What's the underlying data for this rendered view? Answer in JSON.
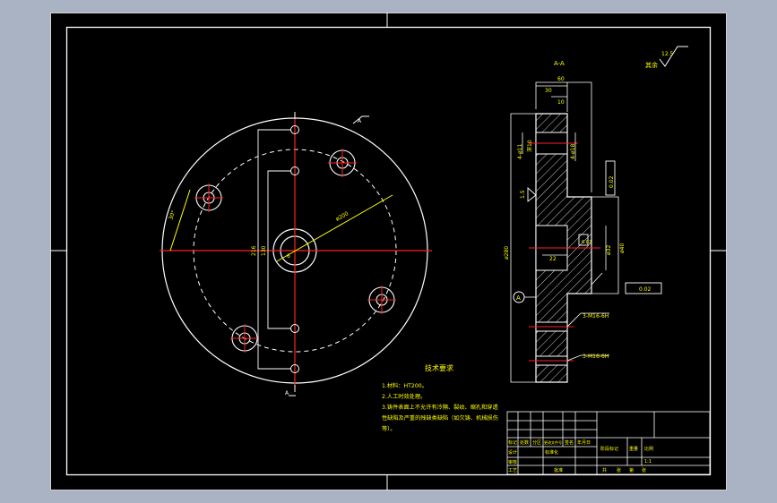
{
  "section_title": "A-A",
  "surface_finish": {
    "value": "12.5",
    "label": "其余"
  },
  "front_view": {
    "dims": {
      "bolt_circle": "ø200",
      "d1": "216",
      "d2": "130",
      "angle": "30°",
      "hole_label": "6"
    },
    "section_marks": [
      "A",
      "A"
    ]
  },
  "section_view": {
    "dims": {
      "overall_width": "60",
      "width2": "30",
      "width3": "10",
      "hole1": "4-ø11",
      "hole1_depth": "深10",
      "hole2": "4-ø18",
      "chamfer": "1.5",
      "outer_dia": "ø280",
      "inner_dia": "ø40",
      "bore": "ø32",
      "bore_depth": "22",
      "perp": "0.02",
      "parallel": "0.02",
      "flat": "0.02",
      "thread1": "3-M16-6H",
      "thread2": "3-M16-6H",
      "datum": "A"
    }
  },
  "notes": {
    "title": "技术要求",
    "lines": [
      "1.材料：HT200。",
      "2.人工时效处理。",
      "3.铸件表面上不允许有冷隔、裂纹、缩孔和穿透",
      "性缺陷及严重的残缺类缺陷（如欠铸、机械损伤",
      "等）。"
    ]
  },
  "title_block": {
    "row_labels": [
      "标记",
      "处数",
      "分区",
      "更改文件号",
      "签名",
      "年月日"
    ],
    "roles": [
      "设计",
      "审核",
      "工艺",
      "标准化",
      "批准"
    ],
    "stage_labels": [
      "阶段标记",
      "重量",
      "比例"
    ],
    "scale": "1:1",
    "sheet_labels": [
      "共",
      "张",
      "第",
      "张"
    ]
  }
}
